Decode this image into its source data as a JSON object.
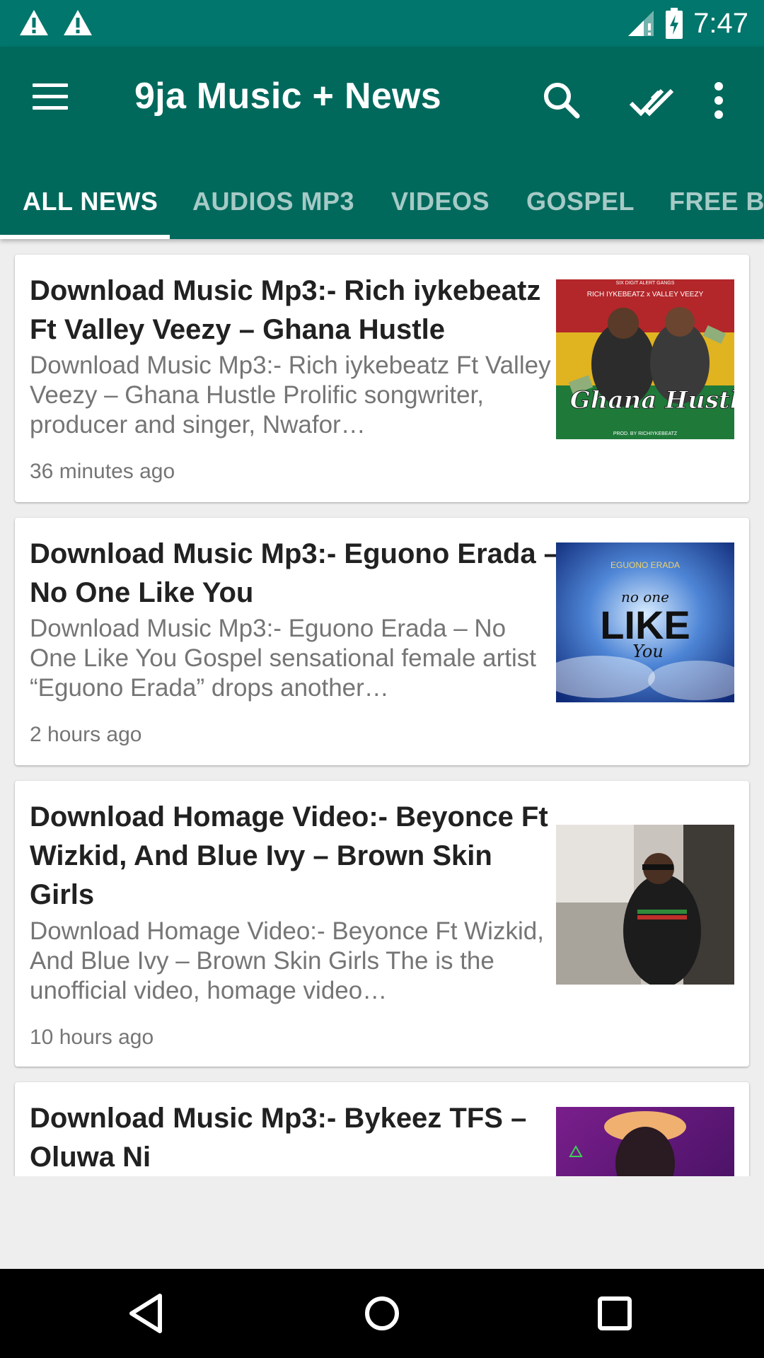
{
  "status_bar": {
    "time": "7:47",
    "icons": [
      "warning-icon",
      "warning-icon",
      "signal-icon",
      "battery-charging-icon"
    ]
  },
  "toolbar": {
    "title": "9ja Music + News",
    "icons": [
      "menu-icon",
      "search-icon",
      "mark-all-read-icon",
      "more-vert-icon"
    ]
  },
  "tabs": [
    {
      "label": "ALL NEWS",
      "active": true
    },
    {
      "label": "AUDIOS MP3",
      "active": false
    },
    {
      "label": "VIDEOS",
      "active": false
    },
    {
      "label": "GOSPEL",
      "active": false
    },
    {
      "label": "FREE BEATS",
      "active": false
    }
  ],
  "articles": [
    {
      "title": "Download Music Mp3:- Rich iykebeatz Ft Valley Veezy – Ghana Hustle",
      "excerpt": "Download Music Mp3:- Rich iykebeatz Ft Valley Veezy – Ghana Hustle Prolific songwriter, producer and singer, Nwafor…",
      "time": "36 minutes ago",
      "thumb": {
        "top_caption": "SIX DIGIT ALERT GANGS",
        "names": "RICH IYKEBEATZ  x  VALLEY VEEZY",
        "script": "Ghana Hustle",
        "bottom_caption": "PROD. BY RICHIYKEBEATZ"
      }
    },
    {
      "title": "Download Music Mp3:- Eguono Erada – No One Like You",
      "excerpt": "Download Music Mp3:- Eguono Erada – No One Like You Gospel sensational female artist “Eguono Erada” drops another…",
      "time": "2 hours ago",
      "thumb": {
        "artist": "EGUONO ERADA",
        "line1": "no one",
        "line2": "LIKE",
        "line3": "You"
      }
    },
    {
      "title": "Download Homage Video:- Beyonce Ft Wizkid, And Blue Ivy – Brown Skin Girls",
      "excerpt": "Download Homage Video:- Beyonce Ft Wizkid, And Blue Ivy – Brown Skin Girls The is the unofficial video, homage video…",
      "time": "10 hours ago"
    },
    {
      "title": "Download Music Mp3:- Bykeez TFS – Oluwa Ni",
      "excerpt": "",
      "time": ""
    }
  ],
  "colors": {
    "status_bar": "#00766c",
    "app_bar": "#00695c",
    "background": "#eeeeee"
  },
  "nav_bar": {
    "buttons": [
      "back-icon",
      "home-icon",
      "recents-icon"
    ]
  }
}
